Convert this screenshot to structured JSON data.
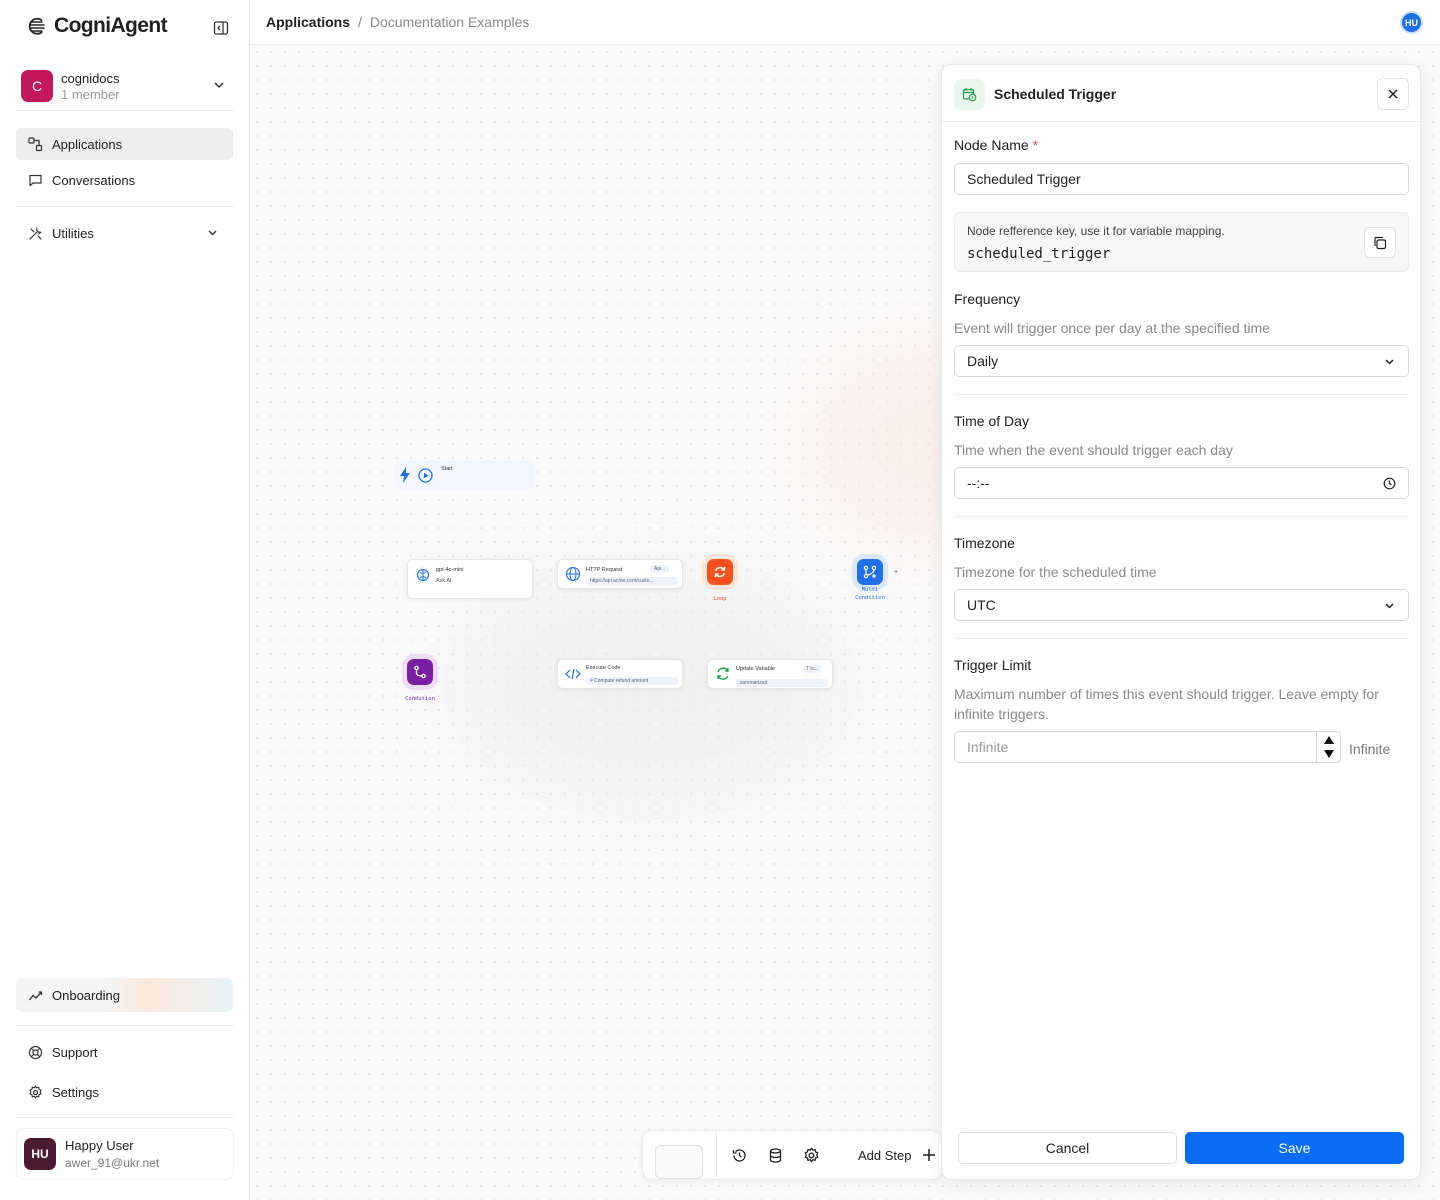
{
  "app": {
    "brand": "CogniAgent"
  },
  "org": {
    "name": "cognidocs",
    "members": "1 member",
    "initial": "C"
  },
  "nav": {
    "applications": "Applications",
    "conversations": "Conversations",
    "utilities": "Utilities",
    "onboarding": "Onboarding",
    "support": "Support",
    "settings": "Settings"
  },
  "user": {
    "name": "Happy User",
    "email": "awer_91@ukr.net",
    "initials": "HU"
  },
  "breadcrumb": {
    "root": "Applications",
    "separator": "/",
    "current": "Documentation Examples"
  },
  "canvas": {
    "nodes": {
      "start": "Start",
      "ai_title": "gpt-4o-mini",
      "ai_sub": "Ask AI",
      "http_title": "HTTP Request",
      "http_chip": "Api...",
      "http_url": "https://api.acme.com/custo...",
      "loop": "Loop",
      "multi_line1": "Multi",
      "multi_line2": "Condition",
      "condition": "Condition",
      "code_title": "Execute Code",
      "code_chip": "#  Compute  refund  amount",
      "update_title": "Update Variable",
      "update_chip": "T ic...",
      "update_value": "summarized"
    },
    "toolbar": {
      "add_step": "Add Step"
    }
  },
  "panel": {
    "title": "Scheduled Trigger",
    "node_name_label": "Node Name",
    "required_mark": "*",
    "node_name_value": "Scheduled Trigger",
    "key_hint": "Node refference key, use it for variable mapping.",
    "key_value": "scheduled_trigger",
    "frequency_label": "Frequency",
    "frequency_hint": "Event will trigger once per day at the specified time",
    "frequency_value": "Daily",
    "time_label": "Time of Day",
    "time_hint": "Time when the event should trigger each day",
    "time_value": "--:--",
    "timezone_label": "Timezone",
    "timezone_hint": "Timezone for the scheduled time",
    "timezone_value": "UTC",
    "limit_label": "Trigger Limit",
    "limit_hint": "Maximum number of times this event should trigger. Leave empty for infinite triggers.",
    "limit_placeholder": "Infinite",
    "limit_suffix": "Infinite",
    "cancel": "Cancel",
    "save": "Save"
  },
  "colors": {
    "accent": "#0a6cf5",
    "org_avatar": "#c2185b",
    "user_avatar": "#4a1a2e",
    "loop": "#f4511e",
    "condition": "#7b1fa2"
  }
}
